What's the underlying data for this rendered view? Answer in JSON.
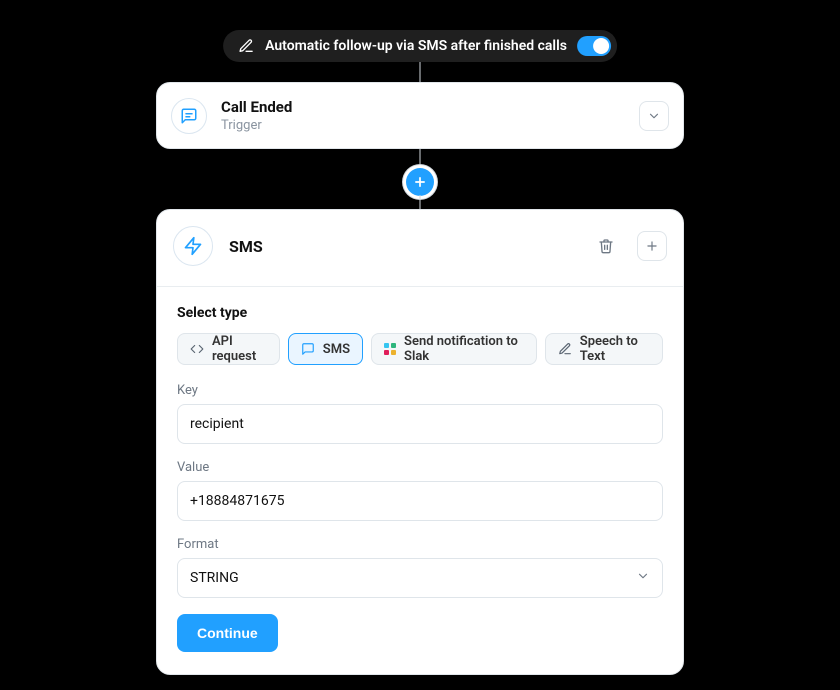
{
  "header": {
    "label": "Automatic follow-up via SMS after finished calls",
    "toggle_on": true
  },
  "trigger": {
    "title": "Call Ended",
    "subtitle": "Trigger"
  },
  "action": {
    "title": "SMS",
    "type_section_label": "Select type",
    "types": [
      {
        "label": "API request",
        "icon": "code",
        "selected": false
      },
      {
        "label": "SMS",
        "icon": "sms",
        "selected": true
      },
      {
        "label": "Send notification to Slak",
        "icon": "slack",
        "selected": false
      },
      {
        "label": "Speech to Text",
        "icon": "pen",
        "selected": false
      }
    ],
    "fields": {
      "key": {
        "label": "Key",
        "value": "recipient"
      },
      "value": {
        "label": "Value",
        "value": "+18884871675"
      },
      "format": {
        "label": "Format",
        "value": "STRING"
      }
    },
    "continue_label": "Continue"
  }
}
